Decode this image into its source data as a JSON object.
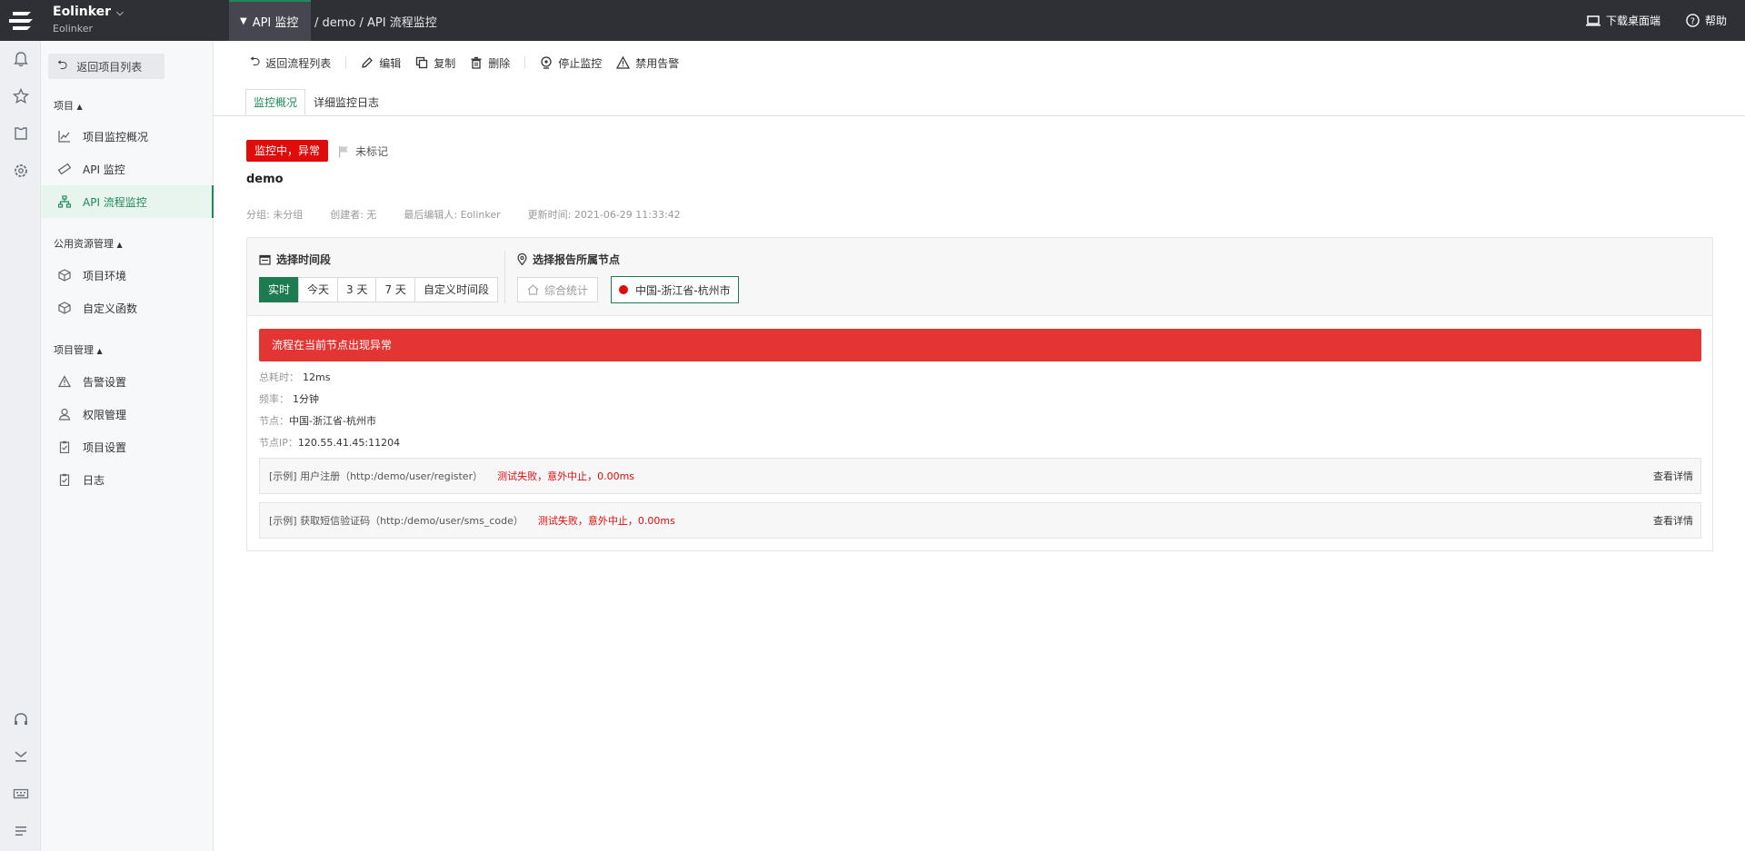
{
  "workspace": {
    "name": "Eolinker",
    "sub": "Eolinker"
  },
  "header": {
    "current_module": "API 监控",
    "breadcrumb": "/ demo / API 流程监控",
    "download": "下载桌面端",
    "help": "帮助"
  },
  "sidebar": {
    "back": "返回项目列表",
    "group_project": "项目",
    "group_public": "公用资源管理",
    "group_manage": "项目管理",
    "items": [
      {
        "label": "项目监控概况",
        "icon": "chart-line-icon"
      },
      {
        "label": "API 监控",
        "icon": "ruler-icon"
      },
      {
        "label": "API 流程监控",
        "icon": "sitemap-icon",
        "active": true
      },
      {
        "label": "项目环境",
        "icon": "cube-icon"
      },
      {
        "label": "自定义函数",
        "icon": "cube-icon"
      },
      {
        "label": "告警设置",
        "icon": "warning-icon"
      },
      {
        "label": "权限管理",
        "icon": "user-icon"
      },
      {
        "label": "项目设置",
        "icon": "clipboard-icon"
      },
      {
        "label": "日志",
        "icon": "clipboard-icon"
      }
    ]
  },
  "toolbar": {
    "back_list": "返回流程列表",
    "edit": "编辑",
    "copy": "复制",
    "delete": "删除",
    "stop": "停止监控",
    "disable_alert": "禁用告警"
  },
  "tabs": {
    "overview": "监控概况",
    "logs": "详细监控日志"
  },
  "flow": {
    "status": "监控中，异常",
    "mark": "未标记",
    "name": "demo",
    "group": "分组: 未分组",
    "creator": "创建者: 无",
    "editor": "最后编辑人: Eolinker",
    "updated": "更新时间:  2021-06-29 11:33:42"
  },
  "filter": {
    "time_title": "选择时间段",
    "node_title": "选择报告所属节点",
    "time_options": [
      "实时",
      "今天",
      "3 天",
      "7 天",
      "自定义时间段"
    ],
    "node_all": "综合统计",
    "node_selected": "中国-浙江省-杭州市"
  },
  "result": {
    "alert": "流程在当前节点出现异常",
    "total_time_label": "总耗时：",
    "total_time": "12ms",
    "freq_label": "频率：",
    "freq": "1分钟",
    "node_label": "节点：",
    "node": "中国-浙江省-杭州市",
    "ip_label": "节点IP：",
    "ip": "120.55.41.45:11204",
    "steps": [
      {
        "name": "[示例] 用户注册（http:/demo/user/register）",
        "status": "测试失败，意外中止，0.00ms",
        "detail": "查看详情"
      },
      {
        "name": "[示例] 获取短信验证码（http:/demo/user/sms_code）",
        "status": "测试失败，意外中止，0.00ms",
        "detail": "查看详情"
      }
    ]
  },
  "colors": {
    "brand_green": "#1e8a5a",
    "error_red": "#e00b0b",
    "alert_red": "#e43535",
    "topbar": "#2f3036"
  }
}
